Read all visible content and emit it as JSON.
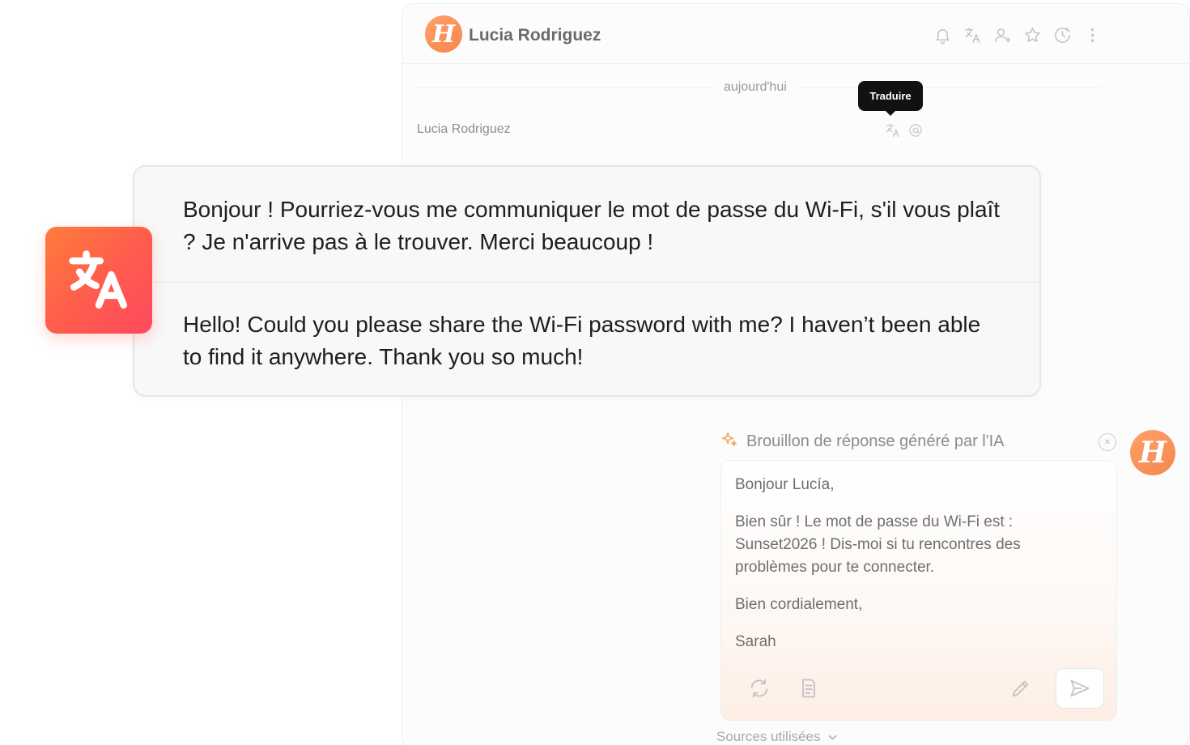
{
  "header": {
    "avatar_letter": "H",
    "contact_name": "Lucia Rodriguez",
    "icons": [
      "bell-icon",
      "translate-icon",
      "add-user-icon",
      "star-icon",
      "clock-icon",
      "more-vertical-icon"
    ]
  },
  "conversation": {
    "day_separator": "aujourd'hui",
    "tooltip": "Traduire",
    "sender": "Lucia Rodriguez",
    "message_icons": [
      "translate-icon",
      "mention-icon"
    ]
  },
  "translation": {
    "original": "Bonjour ! Pourriez-vous me communiquer le mot de passe du Wi-Fi, s'il vous plaît ? Je n'arrive pas à le trouver. Merci beaucoup !",
    "translated": "Hello! Could you please share the Wi-Fi password with me? I haven’t been able to find it anywhere. Thank you so much!"
  },
  "ai_draft": {
    "title": "Brouillon de réponse généré par l'IA",
    "avatar_letter": "H",
    "paragraphs": [
      "Bonjour Lucía,",
      "Bien sûr ! Le mot de passe du Wi-Fi est : Sunset2026 ! Dis-moi si tu rencontres des problèmes pour te connecter.",
      "Bien cordialement,",
      "Sarah"
    ],
    "sources_label": "Sources utilisées"
  },
  "colors": {
    "brand_orange": "#f5874e",
    "badge_gradient_start": "#ff7c3b",
    "badge_gradient_end": "#ff4a60",
    "tooltip_bg": "#111111"
  }
}
